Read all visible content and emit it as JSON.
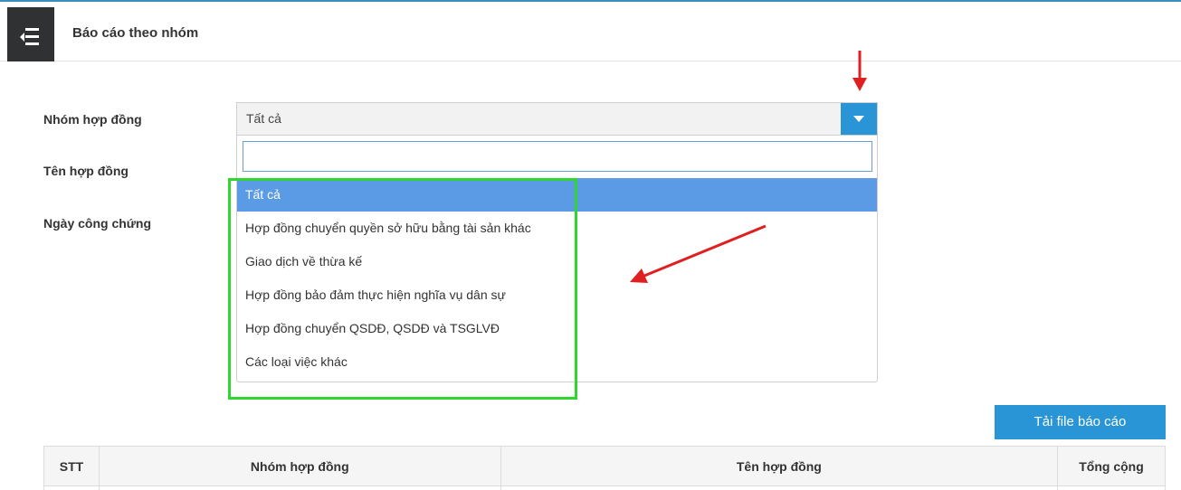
{
  "header": {
    "title": "Báo cáo theo nhóm"
  },
  "form": {
    "labels": {
      "contract_group": "Nhóm hợp đồng",
      "contract_name": "Tên hợp đồng",
      "notary_date": "Ngày công chứng"
    },
    "contract_group_select": {
      "selected_value": "Tất cả",
      "search_value": "",
      "options": [
        "Tất cả",
        "Hợp đồng chuyển quyền sở hữu bằng tài sản khác",
        "Giao dịch về thừa kế",
        "Hợp đồng bảo đảm thực hiện nghĩa vụ dân sự",
        "Hợp đồng chuyển QSDĐ, QSDĐ và TSGLVĐ",
        "Các loại việc khác"
      ],
      "highlighted_index": 0
    }
  },
  "actions": {
    "download_label": "Tải file báo cáo"
  },
  "table": {
    "columns": [
      "STT",
      "Nhóm hợp đồng",
      "Tên hợp đồng",
      "Tổng cộng"
    ]
  },
  "colors": {
    "accent": "#2a95d6",
    "highlight": "#5b9be6",
    "annotation_arrow": "#e02020",
    "annotation_box": "#2fd62f",
    "menu_bg": "#2f3133"
  },
  "icons": {
    "menu": "hamburger-menu-icon",
    "select_toggle": "chevron-down-icon"
  }
}
